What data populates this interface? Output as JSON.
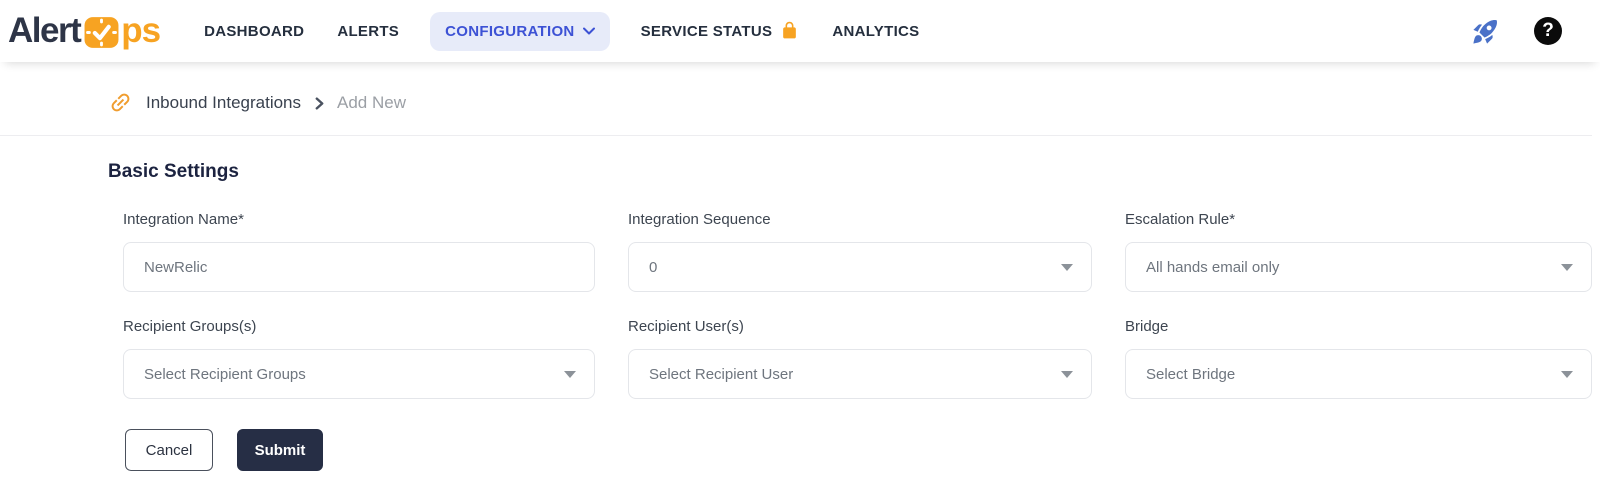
{
  "brand": {
    "name_dark": "Alert",
    "name_orange": "ps",
    "clock_icon": "clock-check-icon",
    "orange": "#F7A322",
    "navy": "#2E3547"
  },
  "nav": {
    "items": [
      {
        "label": "DASHBOARD",
        "active": false
      },
      {
        "label": "ALERTS",
        "active": false
      },
      {
        "label": "CONFIGURATION",
        "active": true,
        "icon": "chevron-down-icon"
      },
      {
        "label": "SERVICE STATUS",
        "active": false,
        "icon": "lock-icon"
      },
      {
        "label": "ANALYTICS",
        "active": false
      }
    ],
    "active_color": "#3D52D5",
    "active_bg": "#E7EBF9",
    "right_icons": [
      {
        "name": "rocket-icon",
        "color": "#4A71C8"
      },
      {
        "name": "help-icon",
        "glyph": "?"
      }
    ]
  },
  "breadcrumb": {
    "icon": "link-icon",
    "icon_color": "#F09D2F",
    "items": [
      {
        "label": "Inbound Integrations",
        "current": false
      },
      {
        "label": "Add New",
        "current": true
      }
    ]
  },
  "page": {
    "section_title": "Basic Settings"
  },
  "form": {
    "fields": [
      {
        "label": "Integration Name*",
        "type": "text",
        "value": "NewRelic",
        "placeholder": ""
      },
      {
        "label": "Integration Sequence",
        "type": "select",
        "value": "0"
      },
      {
        "label": "Escalation Rule*",
        "type": "select",
        "value": "All hands email only"
      },
      {
        "label": "Recipient Groups(s)",
        "type": "select",
        "value": "Select Recipient Groups"
      },
      {
        "label": "Recipient User(s)",
        "type": "select",
        "value": "Select Recipient User"
      },
      {
        "label": "Bridge",
        "type": "select",
        "value": "Select Bridge"
      }
    ],
    "buttons": {
      "cancel": "Cancel",
      "submit": "Submit"
    }
  }
}
